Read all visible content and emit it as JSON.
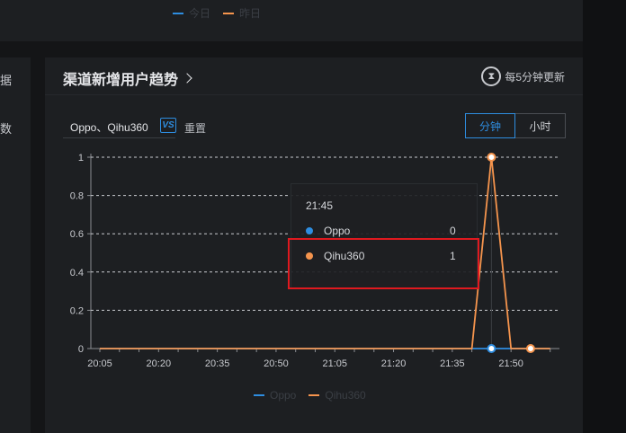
{
  "top_legend": [
    {
      "label": "今日",
      "color": "#2e8de0"
    },
    {
      "label": "昨日",
      "color": "#f5944d"
    }
  ],
  "left_card": {
    "label_1": "据",
    "label_2": "数"
  },
  "card": {
    "title": "渠道新增用户趋势",
    "update_text": "每5分钟更新",
    "filter_value": "Oppo、Qihu360",
    "vs_label": "VS",
    "reset_label": "重置",
    "granularity": {
      "options": [
        "分钟",
        "小时"
      ],
      "selected": "分钟"
    }
  },
  "tooltip": {
    "time": "21:45",
    "rows": [
      {
        "name": "Oppo",
        "value": "0",
        "color": "#2e8de0"
      },
      {
        "name": "Qihu360",
        "value": "1",
        "color": "#f5944d"
      }
    ]
  },
  "chart_data": {
    "type": "line",
    "x": [
      "20:05",
      "20:10",
      "20:15",
      "20:20",
      "20:25",
      "20:30",
      "20:35",
      "20:40",
      "20:45",
      "20:50",
      "20:55",
      "21:00",
      "21:05",
      "21:10",
      "21:15",
      "21:20",
      "21:25",
      "21:30",
      "21:35",
      "21:40",
      "21:45",
      "21:50",
      "21:55",
      "22:00"
    ],
    "x_ticks": [
      "20:05",
      "20:20",
      "20:35",
      "20:50",
      "21:05",
      "21:20",
      "21:35",
      "21:50"
    ],
    "y_ticks": [
      "0",
      "0.2",
      "0.4",
      "0.6",
      "0.8",
      "1"
    ],
    "ylim": [
      0,
      1
    ],
    "grid": true,
    "legend_placement": "bottom",
    "series": [
      {
        "name": "Oppo",
        "color": "#2e8de0",
        "values": [
          0,
          0,
          0,
          0,
          0,
          0,
          0,
          0,
          0,
          0,
          0,
          0,
          0,
          0,
          0,
          0,
          0,
          0,
          0,
          0,
          0,
          0,
          0,
          0
        ]
      },
      {
        "name": "Qihu360",
        "color": "#f5944d",
        "values": [
          0,
          0,
          0,
          0,
          0,
          0,
          0,
          0,
          0,
          0,
          0,
          0,
          0,
          0,
          0,
          0,
          0,
          0,
          0,
          0,
          1,
          0,
          0,
          0
        ]
      }
    ],
    "highlight_index": 20
  }
}
